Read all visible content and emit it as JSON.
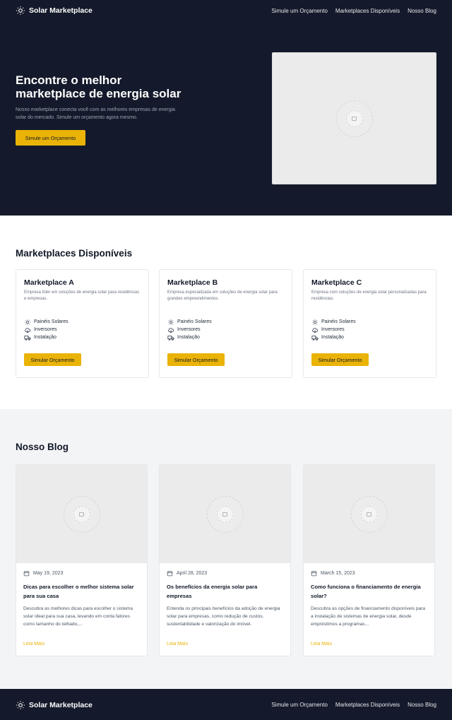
{
  "brand": {
    "name": "Solar Marketplace"
  },
  "nav": {
    "links": [
      "Simule um Orçamento",
      "Marketplaces Disponíveis",
      "Nosso Blog"
    ]
  },
  "hero": {
    "title": "Encontre o melhor marketplace de energia solar",
    "subtitle": "Nosso marketplace conecta você com as melhores empresas de energia solar do mercado. Simule um orçamento agora mesmo.",
    "cta": "Simule um Orçamento"
  },
  "marketplaces": {
    "title": "Marketplaces Disponíveis",
    "items": [
      {
        "name": "Marketplace A",
        "description": "Empresa líder em soluções de energia solar para residências e empresas.",
        "features": [
          "Painéis Solares",
          "Inversores",
          "Instalação"
        ],
        "button": "Simular Orçamento"
      },
      {
        "name": "Marketplace B",
        "description": "Empresa especializada em soluções de energia solar para grandes empreendimentos.",
        "features": [
          "Painéis Solares",
          "Inversores",
          "Instalação"
        ],
        "button": "Simular Orçamento"
      },
      {
        "name": "Marketplace C",
        "description": "Empresa com soluções de energia solar personalizadas para residências.",
        "features": [
          "Painéis Solares",
          "Inversores",
          "Instalação"
        ],
        "button": "Simular Orçamento"
      }
    ]
  },
  "blog": {
    "title": "Nosso Blog",
    "posts": [
      {
        "date": "May 19, 2023",
        "title": "Dicas para escolher o melhor sistema solar para sua casa",
        "excerpt": "Descubra as melhores dicas para escolher o sistema solar ideal para sua casa, levando em conta fatores como tamanho do telhado,...",
        "link": "Leia Mais"
      },
      {
        "date": "April 28, 2023",
        "title": "Os benefícios da energia solar para empresas",
        "excerpt": "Entenda os principais benefícios da adoção de energia solar para empresas, como redução de custos, sustentabilidade e valorização do imóvel.",
        "link": "Leia Mais"
      },
      {
        "date": "March 15, 2023",
        "title": "Como funciona o financiamento de energia solar?",
        "excerpt": "Descubra as opções de financiamento disponíveis para a instalação de sistemas de energia solar, desde empréstimos a programas...",
        "link": "Leia Mais"
      }
    ]
  },
  "footer": {
    "brand": "Solar Marketplace",
    "links": [
      "Simule um Orçamento",
      "Marketplaces Disponíveis",
      "Nosso Blog"
    ]
  },
  "colors": {
    "dark": "#141a2b",
    "accent": "#eab308",
    "gray_bg": "#f3f4f6"
  },
  "icons": {
    "brand": "sun-icon",
    "features": [
      "sun-icon",
      "cloud-icon",
      "truck-icon"
    ],
    "date": "calendar-icon",
    "placeholder": "image-placeholder-icon"
  }
}
